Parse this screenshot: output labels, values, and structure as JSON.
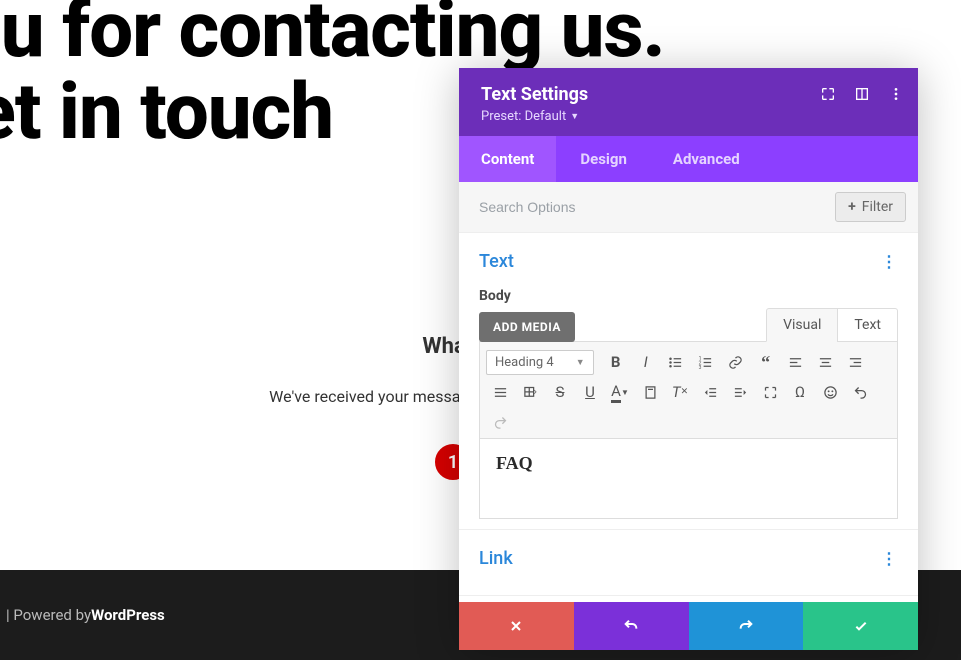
{
  "page": {
    "hero_line1": "k you for contacting us.",
    "hero_line2": "'ll get in touch",
    "whats_next": "What's Next",
    "message": "We've received your message and we'll send you an email w",
    "faq": "FAQ",
    "footer_sep": "| Powered by ",
    "footer_brand": "WordPress"
  },
  "badge": {
    "number": "1"
  },
  "panel": {
    "title": "Text Settings",
    "preset_label": "Preset: Default",
    "tabs": {
      "content": "Content",
      "design": "Design",
      "advanced": "Advanced"
    },
    "search_placeholder": "Search Options",
    "filter_label": "Filter",
    "sections": {
      "text": {
        "title": "Text",
        "body_label": "Body",
        "add_media": "ADD MEDIA",
        "mode_visual": "Visual",
        "mode_text": "Text",
        "format_select": "Heading 4",
        "editor_content": "FAQ"
      },
      "link": {
        "title": "Link"
      }
    }
  },
  "icons": {
    "expand": "expand-icon",
    "drag": "drag-icon",
    "more": "more-icon",
    "plus": "plus-icon",
    "section_menu": "section-menu-icon",
    "bold": "bold-icon",
    "italic": "italic-icon",
    "ul": "bulleted-list-icon",
    "ol": "numbered-list-icon",
    "link": "link-icon",
    "quote": "blockquote-icon",
    "align_left": "align-left-icon",
    "align_center": "align-center-icon",
    "align_right": "align-right-icon",
    "align_justify": "align-justify-icon",
    "table": "table-icon",
    "strike": "strikethrough-icon",
    "underline": "underline-icon",
    "textcolor": "text-color-icon",
    "paste": "paste-icon",
    "clear": "clear-formatting-icon",
    "outdent": "outdent-icon",
    "indent": "indent-icon",
    "fullscreen": "fullscreen-icon",
    "omega": "special-char-icon",
    "emoji": "emoji-icon",
    "undo_tb": "undo-icon",
    "redo_tb": "redo-icon",
    "close": "close-icon",
    "undo": "undo-icon",
    "redo": "redo-icon",
    "check": "check-icon"
  }
}
